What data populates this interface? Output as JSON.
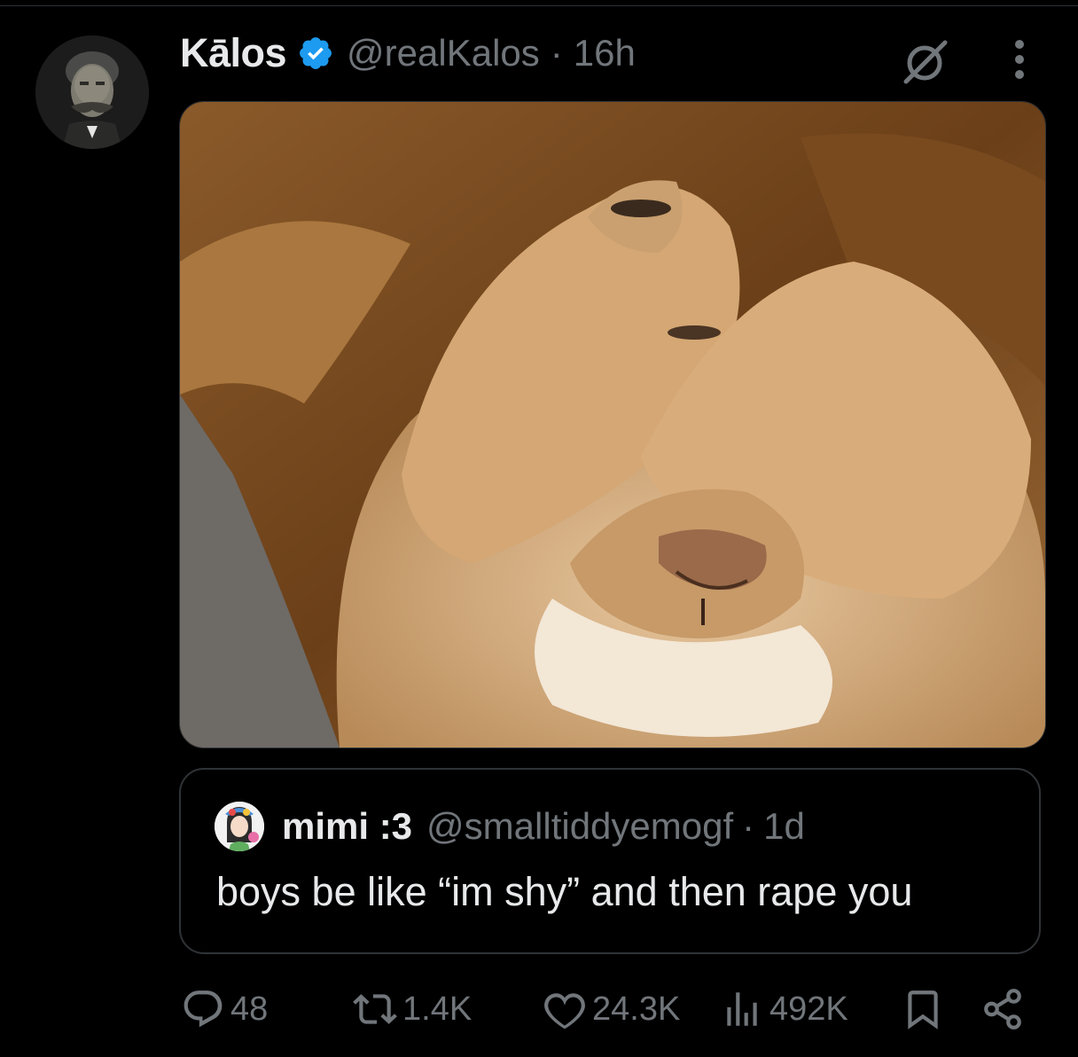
{
  "post": {
    "display_name": "Kālos",
    "handle": "@realKalos",
    "separator": "·",
    "time": "16h",
    "avatar_icon": "bearded-man-statue-avatar",
    "verified_icon": "verified-badge-icon",
    "more_icon": "more-vertical-icon",
    "grok_icon": "grok-icon",
    "media_description_icon": "lion-covering-face-photo"
  },
  "quote": {
    "display_name": "mimi :3",
    "handle": "@smalltiddyemogf",
    "separator": "·",
    "time": "1d",
    "text": "boys be like “im shy” and then rape you"
  },
  "actions": {
    "replies": "48",
    "reposts": "1.4K",
    "likes": "24.3K",
    "views": "492K"
  },
  "colors": {
    "background": "#000000",
    "text_primary": "#e7e9ea",
    "text_secondary": "#71767b",
    "verified": "#1d9bf0",
    "border": "#2f3336"
  }
}
